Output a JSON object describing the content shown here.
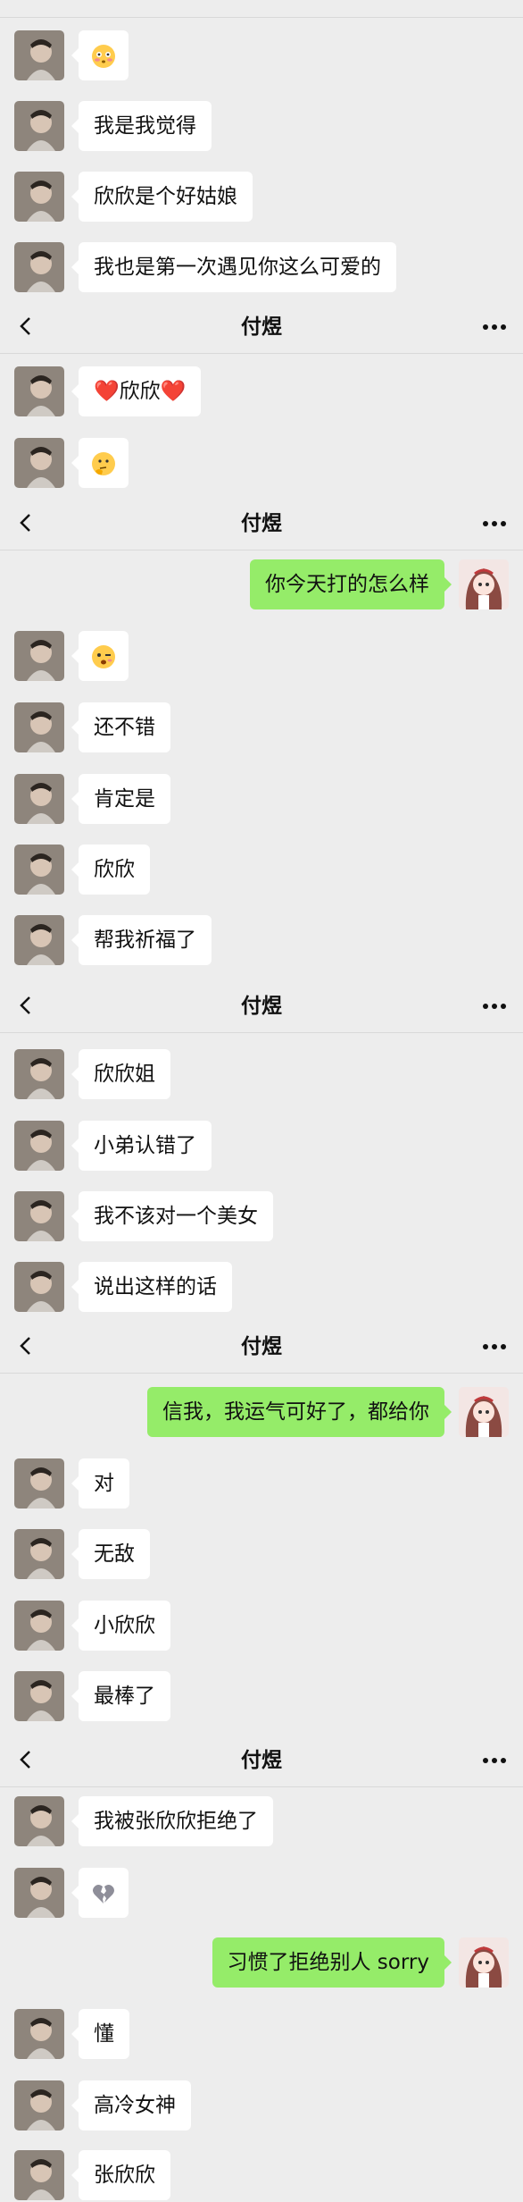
{
  "chat": {
    "contact_name": "付煜",
    "headers": [
      "付煜",
      "付煜",
      "付煜",
      "付煜",
      "付煜",
      "付煜"
    ],
    "messages": [
      {
        "side": "left",
        "emoji": "flushed-face"
      },
      {
        "side": "left",
        "text": "我是我觉得"
      },
      {
        "side": "left",
        "text": "欣欣是个好姑娘"
      },
      {
        "side": "left",
        "text": "我也是第一次遇见你这么可爱的"
      },
      {
        "side": "left",
        "text": "❤️欣欣❤️"
      },
      {
        "side": "left",
        "emoji": "thinking-face"
      },
      {
        "side": "right",
        "text": "你今天打的怎么样"
      },
      {
        "side": "left",
        "emoji": "winking-face"
      },
      {
        "side": "left",
        "text": "还不错"
      },
      {
        "side": "left",
        "text": "肯定是"
      },
      {
        "side": "left",
        "text": "欣欣"
      },
      {
        "side": "left",
        "text": "帮我祈福了"
      },
      {
        "side": "left",
        "text": "欣欣姐"
      },
      {
        "side": "left",
        "text": "小弟认错了"
      },
      {
        "side": "left",
        "text": "我不该对一个美女"
      },
      {
        "side": "left",
        "text": "说出这样的话"
      },
      {
        "side": "right",
        "text": "信我，我运气可好了，都给你"
      },
      {
        "side": "left",
        "text": "对"
      },
      {
        "side": "left",
        "text": "无敌"
      },
      {
        "side": "left",
        "text": "小欣欣"
      },
      {
        "side": "left",
        "text": "最棒了"
      },
      {
        "side": "left",
        "text": "我被张欣欣拒绝了"
      },
      {
        "side": "left",
        "emoji": "broken-heart"
      },
      {
        "side": "right",
        "text": "习惯了拒绝别人 sorry"
      },
      {
        "side": "left",
        "text": "懂"
      },
      {
        "side": "left",
        "text": "高冷女神"
      },
      {
        "side": "left",
        "text": "张欣欣"
      }
    ]
  },
  "colors": {
    "background": "#ededed",
    "bubble_left": "#ffffff",
    "bubble_right": "#95ec69",
    "heart": "#e01b24"
  },
  "icons": {
    "back": "chevron-left-icon",
    "more": "more-dots-icon",
    "avatar_left": "male-avatar",
    "avatar_right": "female-avatar"
  }
}
